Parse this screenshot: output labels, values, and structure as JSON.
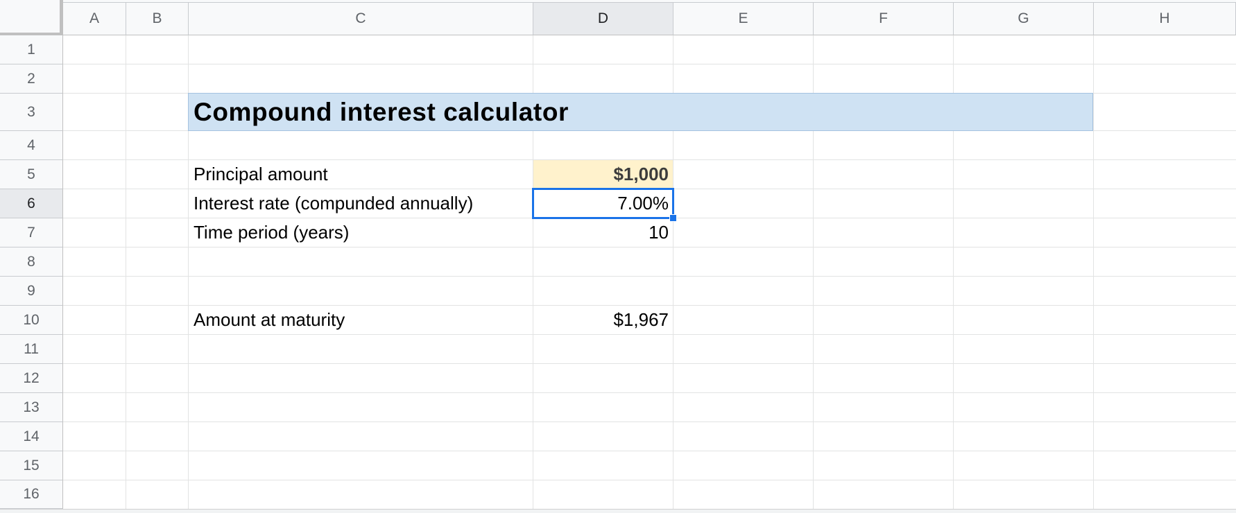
{
  "columns": [
    {
      "label": "A",
      "selected": false
    },
    {
      "label": "B",
      "selected": false
    },
    {
      "label": "C",
      "selected": false
    },
    {
      "label": "D",
      "selected": true
    },
    {
      "label": "E",
      "selected": false
    },
    {
      "label": "F",
      "selected": false
    },
    {
      "label": "G",
      "selected": false
    },
    {
      "label": "H",
      "selected": false
    }
  ],
  "rows": [
    {
      "label": "1",
      "selected": false
    },
    {
      "label": "2",
      "selected": false
    },
    {
      "label": "3",
      "selected": false
    },
    {
      "label": "4",
      "selected": false
    },
    {
      "label": "5",
      "selected": false
    },
    {
      "label": "6",
      "selected": true
    },
    {
      "label": "7",
      "selected": false
    },
    {
      "label": "8",
      "selected": false
    },
    {
      "label": "9",
      "selected": false
    },
    {
      "label": "10",
      "selected": false
    },
    {
      "label": "11",
      "selected": false
    },
    {
      "label": "12",
      "selected": false
    },
    {
      "label": "13",
      "selected": false
    },
    {
      "label": "14",
      "selected": false
    },
    {
      "label": "15",
      "selected": false
    },
    {
      "label": "16",
      "selected": false
    }
  ],
  "sheet": {
    "title": "Compound interest calculator",
    "principal_label": "Principal amount",
    "principal_value": "$1,000",
    "rate_label": "Interest rate (compunded annually)",
    "rate_value": "7.00%",
    "period_label": "Time period (years)",
    "period_value": "10",
    "maturity_label": "Amount at maturity",
    "maturity_value": "$1,967"
  },
  "active_cell": "D6",
  "colors": {
    "title_fill": "#cfe2f3",
    "principal_fill": "#fff2cc",
    "selection": "#1a73e8"
  }
}
